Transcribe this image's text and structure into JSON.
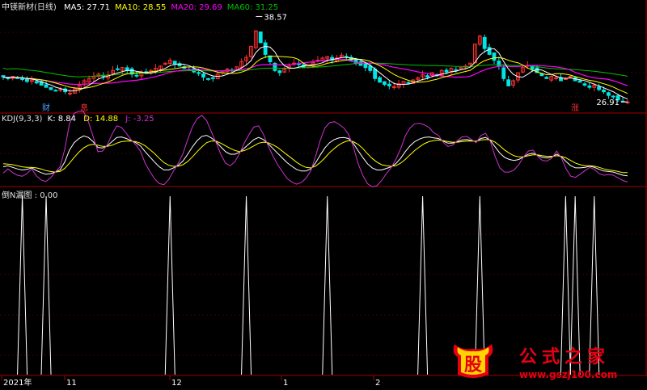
{
  "colors": {
    "background": "#000000",
    "panel_border": "#a00000",
    "grid": "#3a0000",
    "up": "#ff3030",
    "down": "#00e6e6",
    "ma5": "#ffffff",
    "ma10": "#ffff00",
    "ma20": "#ff00ff",
    "ma60": "#00c000",
    "kdj_k": "#ffffff",
    "kdj_d": "#ffff00",
    "kdj_j": "#cc33cc",
    "signal": "#ffffff",
    "watermark": "#e60012"
  },
  "price_panel": {
    "title": "中镁新材(日线)",
    "ma_labels": [
      {
        "name": "MA5",
        "value": "27.71"
      },
      {
        "name": "MA10",
        "value": "28.55"
      },
      {
        "name": "MA20",
        "value": "29.69"
      },
      {
        "name": "MA60",
        "value": "31.25"
      }
    ],
    "high_label": "38.57",
    "low_label": "26.91",
    "event_tags": [
      {
        "text": "财",
        "color": "#4fa0ff"
      },
      {
        "text": "息",
        "color": "#ff3030"
      },
      {
        "text": "涨",
        "color": "#ff3030"
      }
    ]
  },
  "kdj_panel": {
    "title": "KDJ(9,3,3)",
    "k_label": "K: 8.84",
    "d_label": "D: 14.88",
    "j_label": "J: -3.25"
  },
  "signal_panel": {
    "title": "倒N漏图 : 0.00"
  },
  "x_axis": {
    "labels": [
      "2021年",
      "11",
      "12",
      "1",
      "2"
    ]
  },
  "watermark": {
    "badge_text": "股",
    "title": "公式之家",
    "url": "www.gszj100.com"
  },
  "chart_data": [
    {
      "type": "candlestick",
      "name": "中镁新材(日线)",
      "ylim": [
        25.5,
        39.5
      ],
      "high_label": 38.57,
      "low_label": 26.91,
      "close": [
        30.3,
        30.1,
        30.4,
        30.2,
        30.0,
        29.7,
        29.9,
        29.5,
        29.2,
        28.9,
        28.6,
        28.4,
        28.6,
        28.3,
        28.1,
        28.7,
        29.2,
        29.8,
        30.1,
        30.4,
        30.7,
        30.4,
        30.6,
        31.2,
        31.4,
        31.6,
        31.2,
        30.7,
        30.5,
        31.0,
        30.8,
        31.2,
        31.5,
        31.8,
        32.2,
        32.6,
        32.1,
        31.8,
        31.5,
        31.3,
        31.0,
        30.8,
        30.3,
        30.0,
        30.2,
        30.7,
        31.1,
        31.4,
        31.2,
        31.7,
        32.4,
        33.0,
        34.5,
        36.6,
        35.0,
        33.4,
        32.4,
        31.2,
        30.9,
        31.4,
        31.8,
        32.2,
        32.0,
        31.6,
        31.9,
        32.3,
        32.6,
        32.9,
        33.1,
        32.6,
        32.9,
        33.3,
        33.1,
        32.6,
        32.2,
        31.9,
        31.6,
        31.2,
        30.1,
        29.6,
        29.3,
        29.1,
        29.0,
        29.4,
        29.7,
        29.5,
        29.9,
        30.2,
        30.6,
        30.3,
        30.9,
        30.6,
        31.2,
        31.0,
        31.5,
        31.2,
        31.6,
        31.8,
        32.2,
        34.8,
        35.9,
        34.2,
        33.4,
        32.6,
        31.8,
        30.1,
        29.1,
        29.8,
        30.9,
        31.6,
        31.9,
        31.4,
        30.9,
        30.5,
        30.1,
        30.4,
        30.2,
        29.8,
        30.1,
        30.4,
        29.8,
        29.6,
        29.2,
        28.9,
        29.2,
        28.6,
        28.3,
        27.8,
        27.6,
        27.2,
        27.0,
        26.9
      ]
    },
    {
      "type": "line",
      "name": "KDJ(9,3,3)",
      "ylim": [
        -10,
        110
      ],
      "series": [
        {
          "name": "K",
          "values": [
            26,
            28,
            25,
            22,
            20,
            21,
            24,
            19,
            15,
            12,
            13,
            16,
            20,
            35,
            58,
            72,
            80,
            85,
            82,
            74,
            63,
            62,
            66,
            74,
            82,
            83,
            80,
            76,
            72,
            66,
            55,
            45,
            35,
            26,
            20,
            20,
            24,
            29,
            37,
            50,
            64,
            76,
            84,
            86,
            81,
            74,
            64,
            55,
            50,
            50,
            54,
            62,
            70,
            78,
            82,
            78,
            70,
            61,
            52,
            43,
            34,
            27,
            21,
            18,
            18,
            22,
            33,
            48,
            62,
            72,
            78,
            81,
            82,
            80,
            71,
            57,
            44,
            32,
            24,
            20,
            20,
            23,
            26,
            32,
            42,
            55,
            66,
            74,
            79,
            82,
            83,
            81,
            80,
            75,
            71,
            71,
            74,
            77,
            78,
            76,
            74,
            80,
            82,
            76,
            64,
            52,
            44,
            40,
            38,
            40,
            45,
            50,
            52,
            48,
            44,
            43,
            45,
            50,
            45,
            36,
            28,
            24,
            24,
            25,
            27,
            25,
            21,
            18,
            17,
            16,
            13,
            10,
            9
          ]
        },
        {
          "name": "D",
          "values": [
            32,
            31,
            30,
            28,
            26,
            25,
            25,
            24,
            22,
            19,
            17,
            16,
            17,
            23,
            33,
            44,
            54,
            62,
            67,
            69,
            67,
            65,
            65,
            67,
            71,
            74,
            75,
            75,
            74,
            71,
            66,
            59,
            51,
            42,
            34,
            29,
            27,
            27,
            30,
            36,
            45,
            55,
            64,
            72,
            75,
            75,
            71,
            66,
            61,
            57,
            55,
            57,
            61,
            66,
            71,
            73,
            72,
            68,
            63,
            56,
            49,
            42,
            35,
            29,
            25,
            24,
            27,
            34,
            43,
            53,
            61,
            68,
            73,
            76,
            74,
            69,
            61,
            51,
            42,
            35,
            30,
            28,
            27,
            28,
            33,
            40,
            49,
            57,
            64,
            70,
            74,
            76,
            77,
            76,
            74,
            73,
            73,
            74,
            75,
            75,
            75,
            77,
            78,
            77,
            73,
            66,
            58,
            52,
            47,
            45,
            45,
            47,
            49,
            49,
            47,
            46,
            46,
            47,
            46,
            43,
            38,
            33,
            30,
            28,
            28,
            27,
            25,
            22,
            20,
            19,
            17,
            15,
            15
          ]
        },
        {
          "name": "J",
          "values": [
            14,
            22,
            15,
            10,
            8,
            13,
            22,
            9,
            1,
            -2,
            5,
            16,
            26,
            59,
            108,
            128,
            132,
            131,
            112,
            84,
            55,
            56,
            68,
            88,
            104,
            101,
            90,
            78,
            68,
            56,
            33,
            17,
            3,
            -6,
            -8,
            2,
            18,
            33,
            51,
            78,
            102,
            118,
            124,
            114,
            93,
            72,
            50,
            33,
            28,
            36,
            52,
            72,
            88,
            102,
            104,
            88,
            66,
            47,
            30,
            17,
            4,
            -3,
            -7,
            -4,
            4,
            18,
            45,
            76,
            100,
            110,
            112,
            107,
            100,
            88,
            65,
            33,
            10,
            -6,
            -12,
            -10,
            0,
            13,
            24,
            40,
            60,
            85,
            100,
            108,
            109,
            106,
            101,
            91,
            86,
            73,
            65,
            67,
            76,
            83,
            84,
            78,
            72,
            86,
            90,
            74,
            46,
            24,
            16,
            16,
            20,
            30,
            45,
            56,
            58,
            46,
            38,
            37,
            43,
            56,
            43,
            22,
            8,
            6,
            12,
            19,
            25,
            21,
            13,
            10,
            11,
            10,
            5,
            0,
            -3
          ]
        }
      ]
    },
    {
      "type": "bar",
      "name": "倒N漏图",
      "ylim": [
        0,
        1
      ],
      "value": 0.0,
      "signal_bar_index": [
        4,
        9,
        35,
        51,
        68,
        88,
        100,
        118,
        120,
        124
      ]
    }
  ]
}
